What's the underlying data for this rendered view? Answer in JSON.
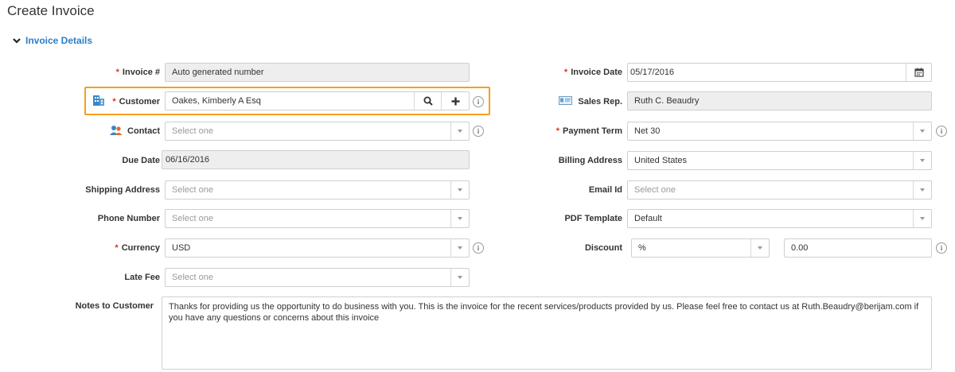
{
  "page": {
    "title": "Create Invoice"
  },
  "section": {
    "title": "Invoice Details"
  },
  "left": {
    "invoice_no": {
      "label": "Invoice #",
      "value": "Auto generated number"
    },
    "customer": {
      "label": "Customer",
      "value": "Oakes, Kimberly A Esq"
    },
    "contact": {
      "label": "Contact",
      "placeholder": "Select one"
    },
    "due_date": {
      "label": "Due Date",
      "value": "06/16/2016"
    },
    "shipping_address": {
      "label": "Shipping Address",
      "placeholder": "Select one"
    },
    "phone_number": {
      "label": "Phone Number",
      "placeholder": "Select one"
    },
    "currency": {
      "label": "Currency",
      "value": "USD"
    },
    "late_fee": {
      "label": "Late Fee",
      "placeholder": "Select one"
    }
  },
  "right": {
    "invoice_date": {
      "label": "Invoice Date",
      "value": "05/17/2016"
    },
    "sales_rep": {
      "label": "Sales Rep.",
      "value": "Ruth C. Beaudry"
    },
    "payment_term": {
      "label": "Payment Term",
      "value": "Net 30"
    },
    "billing_address": {
      "label": "Billing Address",
      "value": "United States"
    },
    "email_id": {
      "label": "Email Id",
      "placeholder": "Select one"
    },
    "pdf_template": {
      "label": "PDF Template",
      "value": "Default"
    },
    "discount": {
      "label": "Discount",
      "type_value": "%",
      "amount": "0.00"
    }
  },
  "notes": {
    "label": "Notes to Customer",
    "value": "Thanks for providing us the opportunity to do business with you. This is the invoice for the recent services/products provided by us. Please feel free to contact us at Ruth.Beaudry@berijam.com if you have any questions or concerns about this invoice"
  },
  "icons": {
    "info": "info-icon",
    "search": "search-icon",
    "add": "plus-icon",
    "calendar": "calendar-icon",
    "customer": "building-icon",
    "contact": "contact-person-icon",
    "sales_rep": "id-card-icon",
    "section_toggle": "chevron-down-icon"
  },
  "colors": {
    "accent": "#2a7ec4",
    "required": "#d9342b",
    "highlight": "#f5a01a",
    "readonly_bg": "#eeeeee"
  },
  "glyphs": {
    "info": "i",
    "required": "*"
  }
}
